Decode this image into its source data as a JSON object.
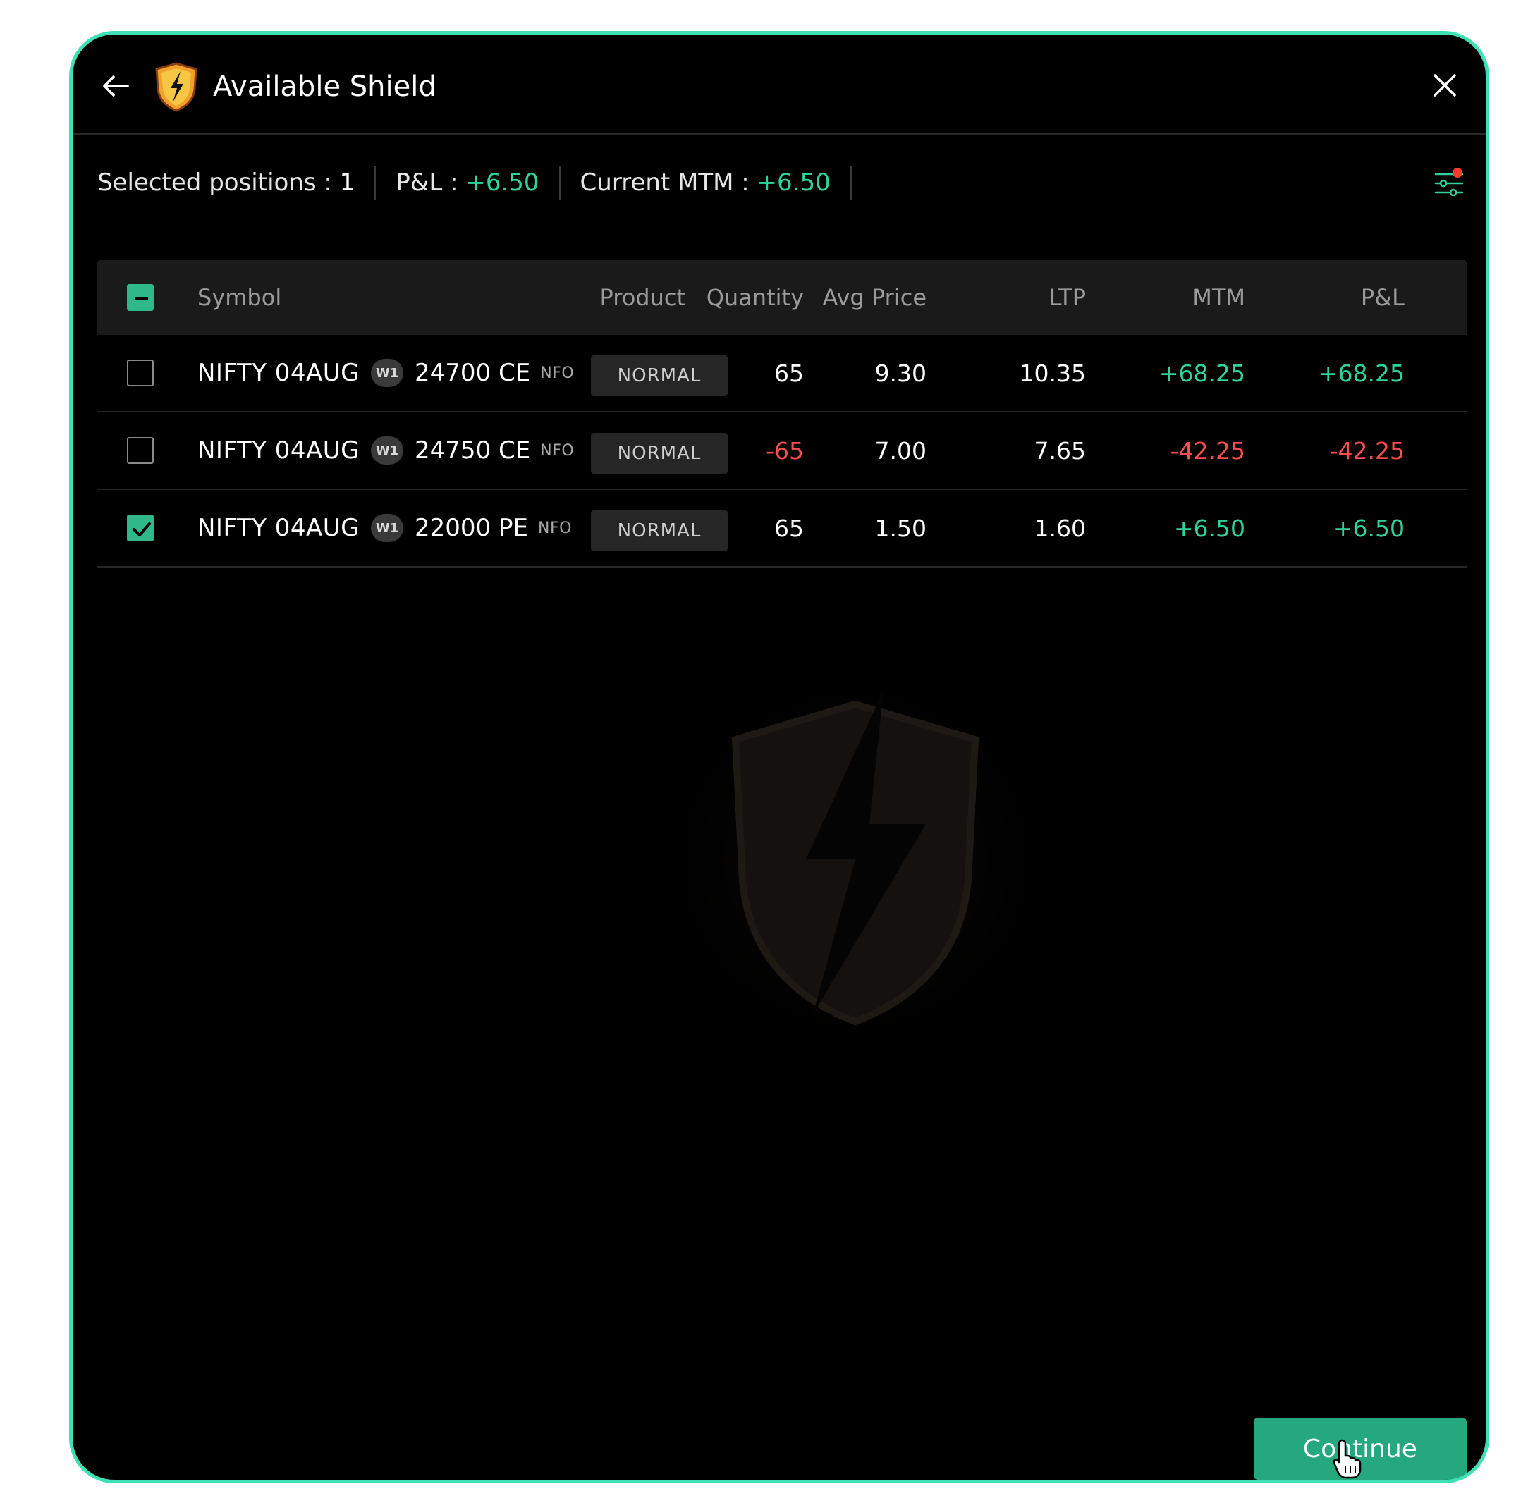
{
  "header": {
    "title": "Available Shield",
    "back_icon": "arrow-left-icon",
    "close_icon": "close-icon",
    "logo_icon": "shield-lightning-icon"
  },
  "summary": {
    "selected_label": "Selected positions : ",
    "selected_value": "1",
    "pnl_label": "P&L : ",
    "pnl_value": "+6.50",
    "mtm_label": "Current MTM : ",
    "mtm_value": "+6.50",
    "filter_icon": "filter-sliders-icon"
  },
  "table": {
    "columns": [
      "Symbol",
      "Product",
      "Quantity",
      "Avg Price",
      "LTP",
      "MTM",
      "P&L"
    ],
    "select_all_state": "partial",
    "rows": [
      {
        "checked": false,
        "symbol": "NIFTY 04AUG",
        "week": "W1",
        "strike": "24700 CE",
        "exchange": "NFO",
        "product": "NORMAL",
        "quantity": "65",
        "avg_price": "9.30",
        "ltp": "10.35",
        "mtm": "+68.25",
        "pnl": "+68.25",
        "quantity_sign": "pos",
        "mtm_sign": "pos",
        "pnl_sign": "pos"
      },
      {
        "checked": false,
        "symbol": "NIFTY 04AUG",
        "week": "W1",
        "strike": "24750 CE",
        "exchange": "NFO",
        "product": "NORMAL",
        "quantity": "-65",
        "avg_price": "7.00",
        "ltp": "7.65",
        "mtm": "-42.25",
        "pnl": "-42.25",
        "quantity_sign": "neg",
        "mtm_sign": "neg",
        "pnl_sign": "neg"
      },
      {
        "checked": true,
        "symbol": "NIFTY 04AUG",
        "week": "W1",
        "strike": "22000 PE",
        "exchange": "NFO",
        "product": "NORMAL",
        "quantity": "65",
        "avg_price": "1.50",
        "ltp": "1.60",
        "mtm": "+6.50",
        "pnl": "+6.50",
        "quantity_sign": "plain",
        "mtm_sign": "pos",
        "pnl_sign": "pos"
      }
    ]
  },
  "footer": {
    "continue_label": "Continue"
  },
  "colors": {
    "accent": "#2fb88a",
    "positive": "#2fd39a",
    "negative": "#ff4d4d",
    "border": "#3fe0b4"
  }
}
